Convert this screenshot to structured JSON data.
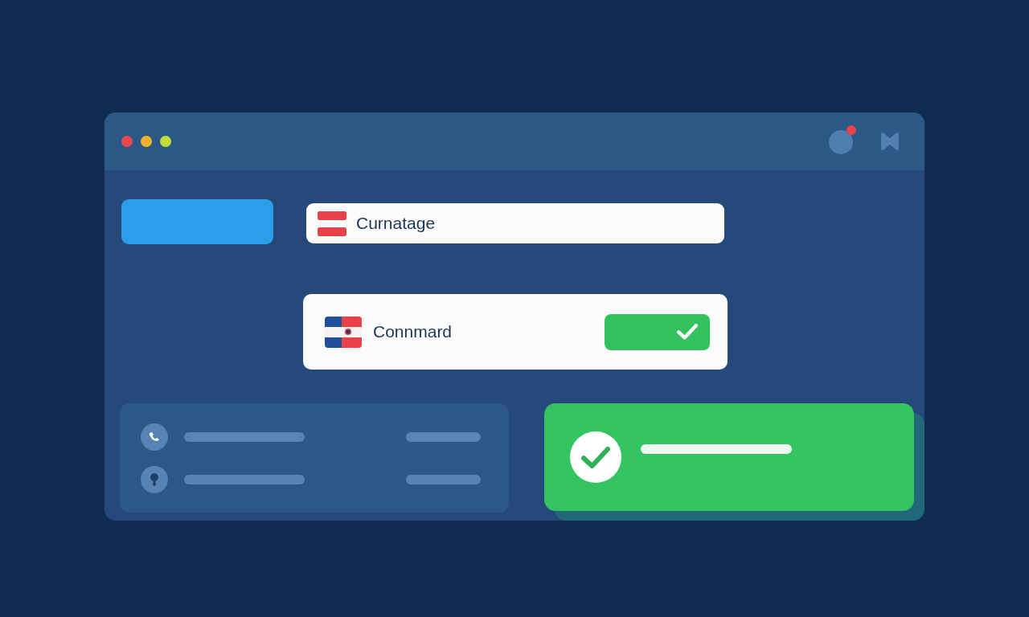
{
  "header": {
    "notification": true
  },
  "field": {
    "value": "Curnatage"
  },
  "card": {
    "label": "Connmard"
  }
}
